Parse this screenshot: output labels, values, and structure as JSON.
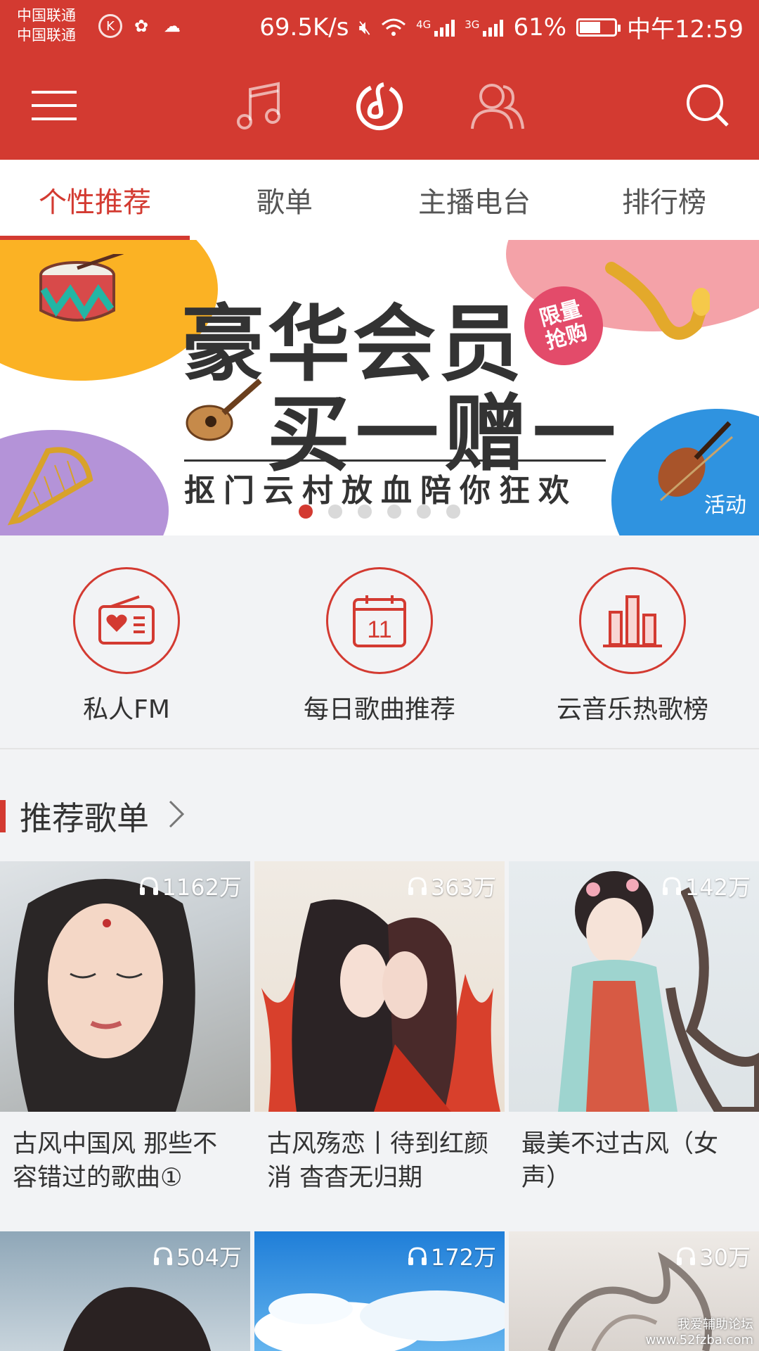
{
  "status_bar": {
    "carrier_1": "中国联通",
    "carrier_2": "中国联通",
    "net_speed": "69.5K/s",
    "signal_1_tag": "4G",
    "signal_2_tag": "3G",
    "battery": "61%",
    "battery_level": 0.61,
    "time": "中午12:59"
  },
  "header": {
    "menu_icon": "menu-icon",
    "music_icon": "music-note-icon",
    "discover_icon": "netease-logo-icon",
    "friends_icon": "friends-icon",
    "search_icon": "search-icon"
  },
  "tabs": [
    {
      "label": "个性推荐",
      "active": true
    },
    {
      "label": "歌单",
      "active": false
    },
    {
      "label": "主播电台",
      "active": false
    },
    {
      "label": "排行榜",
      "active": false
    }
  ],
  "banner": {
    "title_line1": "豪华会员",
    "title_line2": "买一赠一",
    "subtitle": "抠门云村放血陪你狂欢",
    "badge_line1": "限量",
    "badge_line2": "抢购",
    "tag": "活动",
    "dot_count": 6,
    "active_dot": 0
  },
  "quick_entries": [
    {
      "label": "私人FM",
      "icon": "radio-heart-icon"
    },
    {
      "label": "每日歌曲推荐",
      "icon": "calendar-icon",
      "day": "11"
    },
    {
      "label": "云音乐热歌榜",
      "icon": "bar-chart-icon"
    }
  ],
  "section": {
    "title": "推荐歌单"
  },
  "playlists": [
    {
      "plays": "1162万",
      "title": "古风中国风 那些不容错过的歌曲①"
    },
    {
      "plays": "363万",
      "title": "古风殇恋丨待到红颜消 杳杳无归期"
    },
    {
      "plays": "142万",
      "title": "最美不过古风（女声）"
    },
    {
      "plays": "504万",
      "title": ""
    },
    {
      "plays": "172万",
      "title": ""
    },
    {
      "plays": "30万",
      "title": ""
    }
  ],
  "watermark": {
    "line1": "我爱辅助论坛",
    "line2": "www.52fzba.com"
  },
  "colors": {
    "brand_red": "#d33a31",
    "background": "#f2f3f5"
  }
}
